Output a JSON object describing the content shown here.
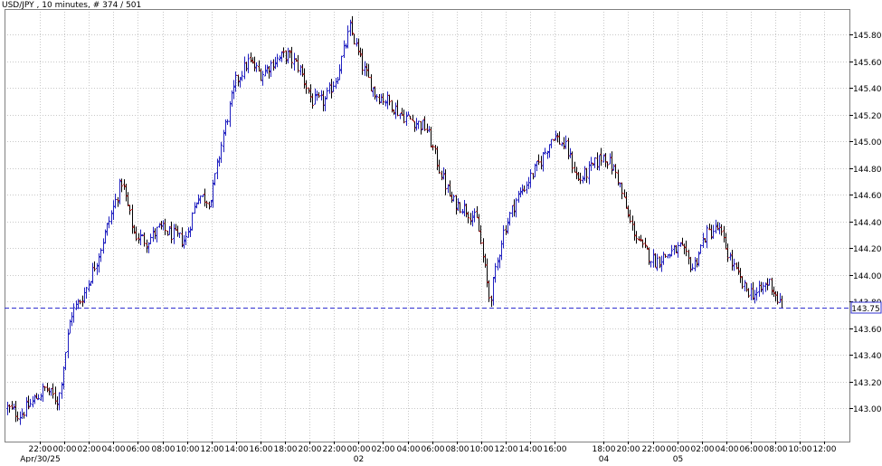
{
  "header": {
    "symbol": "USD/JPY",
    "timeframe": "10 minutes",
    "counter": "# 374 / 501"
  },
  "price_tag": "143.75",
  "colors": {
    "up": "#2020c0",
    "down": "#c01818",
    "wick": "#000000",
    "grid": "#c8c8c8",
    "price_line": "#3030d0",
    "price_tag_text": "#c01818",
    "price_tag_border": "#3030d0"
  },
  "chart_data": {
    "type": "ohlc",
    "title": "USD/JPY , 10 minutes , # 374 / 501",
    "ylim": [
      142.85,
      145.95
    ],
    "grid": true,
    "y_ticks": [
      "145.80",
      "145.60",
      "145.40",
      "145.20",
      "145.00",
      "144.80",
      "144.60",
      "144.40",
      "144.20",
      "144.00",
      "143.80",
      "143.60",
      "143.40",
      "143.20",
      "143.00"
    ],
    "x_ticks": [
      {
        "idx": 0,
        "time": "22:00",
        "date": "Apr/30/25"
      },
      {
        "idx": 1,
        "time": "00:00"
      },
      {
        "idx": 2,
        "time": "02:00"
      },
      {
        "idx": 3,
        "time": "04:00"
      },
      {
        "idx": 4,
        "time": "06:00"
      },
      {
        "idx": 5,
        "time": "08:00"
      },
      {
        "idx": 6,
        "time": "10:00"
      },
      {
        "idx": 7,
        "time": "12:00"
      },
      {
        "idx": 8,
        "time": "14:00"
      },
      {
        "idx": 9,
        "time": "16:00"
      },
      {
        "idx": 10,
        "time": "18:00"
      },
      {
        "idx": 11,
        "time": "20:00"
      },
      {
        "idx": 12,
        "time": "22:00"
      },
      {
        "idx": 13,
        "time": "00:00",
        "date": "02"
      },
      {
        "idx": 14,
        "time": "02:00"
      },
      {
        "idx": 15,
        "time": "04:00"
      },
      {
        "idx": 16,
        "time": "06:00"
      },
      {
        "idx": 17,
        "time": "08:00"
      },
      {
        "idx": 18,
        "time": "10:00"
      },
      {
        "idx": 19,
        "time": "12:00"
      },
      {
        "idx": 20,
        "time": "14:00"
      },
      {
        "idx": 21,
        "time": "16:00"
      },
      {
        "idx": 23,
        "time": "18:00",
        "date": "04"
      },
      {
        "idx": 24,
        "time": "20:00"
      },
      {
        "idx": 25,
        "time": "22:00"
      },
      {
        "idx": 26,
        "time": "00:00",
        "date": "05"
      },
      {
        "idx": 27,
        "time": "02:00"
      },
      {
        "idx": 28,
        "time": "04:00"
      },
      {
        "idx": 29,
        "time": "06:00"
      },
      {
        "idx": 30,
        "time": "08:00"
      },
      {
        "idx": 31,
        "time": "10:00"
      },
      {
        "idx": 32,
        "time": "12:00"
      }
    ],
    "last_price": 143.75,
    "path": [
      [
        0,
        143.0
      ],
      [
        1,
        142.95
      ],
      [
        2,
        143.05
      ],
      [
        3,
        143.15
      ],
      [
        4,
        143.05
      ],
      [
        5,
        143.7
      ],
      [
        6,
        143.85
      ],
      [
        7,
        144.1
      ],
      [
        8,
        144.4
      ],
      [
        9,
        144.7
      ],
      [
        10,
        144.3
      ],
      [
        11,
        144.25
      ],
      [
        12,
        144.35
      ],
      [
        13,
        144.3
      ],
      [
        14,
        144.25
      ],
      [
        15,
        144.6
      ],
      [
        16,
        144.55
      ],
      [
        17,
        145.05
      ],
      [
        18,
        145.45
      ],
      [
        19,
        145.6
      ],
      [
        20,
        145.5
      ],
      [
        21,
        145.6
      ],
      [
        22,
        145.65
      ],
      [
        23,
        145.55
      ],
      [
        24,
        145.3
      ],
      [
        25,
        145.3
      ],
      [
        26,
        145.5
      ],
      [
        27,
        145.85
      ],
      [
        28,
        145.55
      ],
      [
        29,
        145.35
      ],
      [
        30,
        145.3
      ],
      [
        31,
        145.2
      ],
      [
        32,
        145.15
      ],
      [
        33,
        145.1
      ],
      [
        34,
        144.8
      ],
      [
        35,
        144.55
      ],
      [
        36,
        144.5
      ],
      [
        37,
        144.4
      ],
      [
        38,
        143.8
      ],
      [
        39,
        144.3
      ],
      [
        40,
        144.55
      ],
      [
        41,
        144.7
      ],
      [
        42,
        144.85
      ],
      [
        43,
        145.05
      ],
      [
        44,
        144.95
      ],
      [
        45,
        144.7
      ],
      [
        46,
        144.8
      ],
      [
        47,
        144.9
      ],
      [
        48,
        144.75
      ],
      [
        49,
        144.4
      ],
      [
        50,
        144.2
      ],
      [
        51,
        144.1
      ],
      [
        52,
        144.15
      ],
      [
        53,
        144.2
      ],
      [
        54,
        144.05
      ],
      [
        55,
        144.3
      ],
      [
        56,
        144.35
      ],
      [
        57,
        144.1
      ],
      [
        58,
        143.9
      ],
      [
        59,
        143.85
      ],
      [
        60,
        143.95
      ],
      [
        61,
        143.75
      ]
    ]
  }
}
